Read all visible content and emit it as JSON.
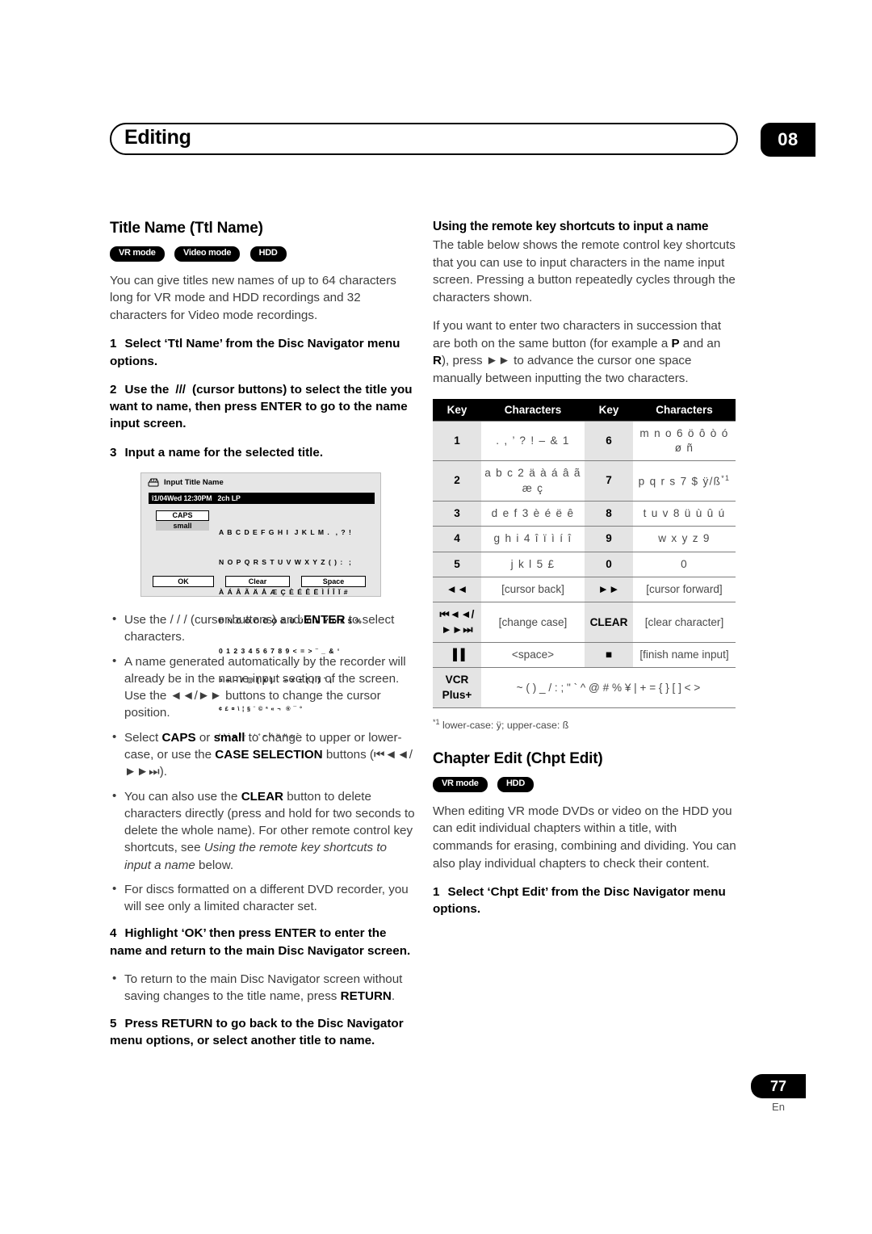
{
  "header": {
    "title": "Editing",
    "chapter": "08"
  },
  "footer": {
    "page_number": "77",
    "language": "En"
  },
  "left_column": {
    "section_title": "Title Name (Ttl Name)",
    "badges": [
      "VR mode",
      "Video mode",
      "HDD"
    ],
    "intro": "You can give titles new names of up to 64 characters long for VR mode and HDD recordings and 32 characters for Video mode recordings.",
    "step1": "Select ‘Ttl Name’ from the Disc Navigator menu options.",
    "step1_num": "1",
    "step2_num": "2",
    "step2_a": "Use the",
    "step2_b": "/",
    "step2_c": "/",
    "step2_d": "/",
    "step2_e": "(cursor buttons) to select the title you want to name, then press ENTER to go to the name input screen.",
    "step3_num": "3",
    "step3": "Input a name for the selected title.",
    "bullets": [
      {
        "pre": "Use the ",
        "mid": " /  /  /  ",
        "post": "(cursor buttons) and ",
        "bold1": "ENTER",
        "tail": " to select characters."
      },
      {
        "text": "A name generated automatically by the recorder will already be in the name input section of the screen. Use the ◄◄/►► buttons to change the cursor position."
      },
      {
        "text_a": "Select ",
        "bold_a": "CAPS",
        "text_b": " or ",
        "bold_b": "small",
        "text_c": " to change to upper or lower-case, or use the ",
        "bold_c": "CASE SELECTION",
        "text_d": " buttons (⏮◄◄/►►⏭)."
      },
      {
        "text_a": "You can also use the ",
        "bold_a": "CLEAR",
        "text_b": " button to delete characters directly (press and hold for two seconds to delete the whole name). For other remote control key shortcuts, see ",
        "italic_a": "Using the remote key shortcuts to input a name",
        "text_c": " below."
      },
      {
        "text": "For discs formatted on a different DVD recorder, you will see only a limited character set."
      }
    ],
    "step4_num": "4",
    "step4": "Highlight ‘OK’ then press ENTER to enter the name and return to the main Disc Navigator screen.",
    "step4_bullet_a": "To return to the main Disc Navigator screen without saving changes to the title name, press ",
    "step4_bullet_bold": "RETURN",
    "step4_bullet_b": ".",
    "step5_num": "5",
    "step5": "Press RETURN to go back to the Disc Navigator menu options, or select another title to name."
  },
  "osd_screen": {
    "icon_name": "hdd-disc-icon",
    "title": "Input Title Name",
    "status_bar_left": "î1/04Wed 12:30PM",
    "status_bar_right": "2ch LP",
    "case_caps": "CAPS",
    "case_small": "small",
    "char_rows": [
      "A B C D E F G H I  J K L M .  , ? !",
      "N O P Q R S T U V W X Y Z ( ) :  ;",
      "À Á Â Ã Ä Å Æ Ç È É Ê Ë Ì Í Î Ï #",
      "Ð Ñ Ò Ó Ô Õ Ö Ø Ù Ú Û Ü Ý Þ ß $ %",
      "0 1 2 3 4 5 6 7 8 9 < = > ¨ _ & ‘",
      "¤ + – / @ [ ¥ ] ¯ ÷ × ± { | } ˜ ¡",
      "¢ £ ¤ \\ ¦ § ¨ © ª « ¬ ­ ® ¯ °",
      "² ³ ´ µ ¶ · ¸ ¹ º » ¼ ½ ¾ ¿ ˇ"
    ],
    "button_ok": "OK",
    "button_clear": "Clear",
    "button_space": "Space"
  },
  "right_column": {
    "subsection_title": "Using the remote key shortcuts to input a name",
    "para1": "The table below shows the remote control key shortcuts that you can use to input characters in the name input screen. Pressing a button repeatedly cycles through the characters shown.",
    "para2_a": "If you want to enter two characters in succession that are both on the same button (for example a ",
    "para2_bold_p": "P",
    "para2_b": " and an ",
    "para2_bold_r": "R",
    "para2_c": "), press ►► to advance the cursor one space manually between inputting the two characters.",
    "table": {
      "headers": [
        "Key",
        "Characters",
        "Key",
        "Characters"
      ],
      "rows": [
        {
          "key_l": "1",
          "chars_l": ". , ’ ? ! – & 1",
          "key_r": "6",
          "chars_r": "m n o 6 ö ô ò ó ø ñ"
        },
        {
          "key_l": "2",
          "chars_l": "a b c 2 ä à á â ã æ ç",
          "key_r": "7",
          "chars_r": "p q r s 7 $ ÿ/ß",
          "chars_r_sup": "*1"
        },
        {
          "key_l": "3",
          "chars_l": "d e f 3 è é ë ê",
          "key_r": "8",
          "chars_r": "t u v 8 ü ù û ú"
        },
        {
          "key_l": "4",
          "chars_l": "g h i 4 î ï ì í î",
          "key_r": "9",
          "chars_r": "w x y z 9"
        },
        {
          "key_l": "5",
          "chars_l": "j k l 5 £",
          "key_r": "0",
          "chars_r": "0"
        },
        {
          "key_l": "◄◄",
          "chars_l": "[cursor back]",
          "key_r": "►►",
          "chars_r": "[cursor forward]"
        },
        {
          "key_l": "⏮◄◄/►►⏭",
          "chars_l": "[change case]",
          "key_r": "CLEAR",
          "chars_r": "[clear character]"
        },
        {
          "key_l": "▐▐",
          "chars_l": "<space>",
          "key_r": "■",
          "chars_r": "[finish name input]"
        }
      ],
      "last_row": {
        "key": "VCR Plus+",
        "chars": "~ ( ) _ / : ; \" ` ^ @ #   % ¥ | + =  { } [ ] < >"
      }
    },
    "footnote_sup": "*1",
    "footnote_text": "lower-case: ÿ; upper-case: ß",
    "section2_title": "Chapter Edit (Chpt Edit)",
    "section2_badges": [
      "VR mode",
      "HDD"
    ],
    "section2_para": "When editing VR mode DVDs or video on the HDD you can edit individual chapters within a title, with commands for erasing, combining and dividing. You can also play individual chapters to check their content.",
    "section2_step1_num": "1",
    "section2_step1": "Select ‘Chpt Edit’ from the Disc Navigator menu options."
  }
}
